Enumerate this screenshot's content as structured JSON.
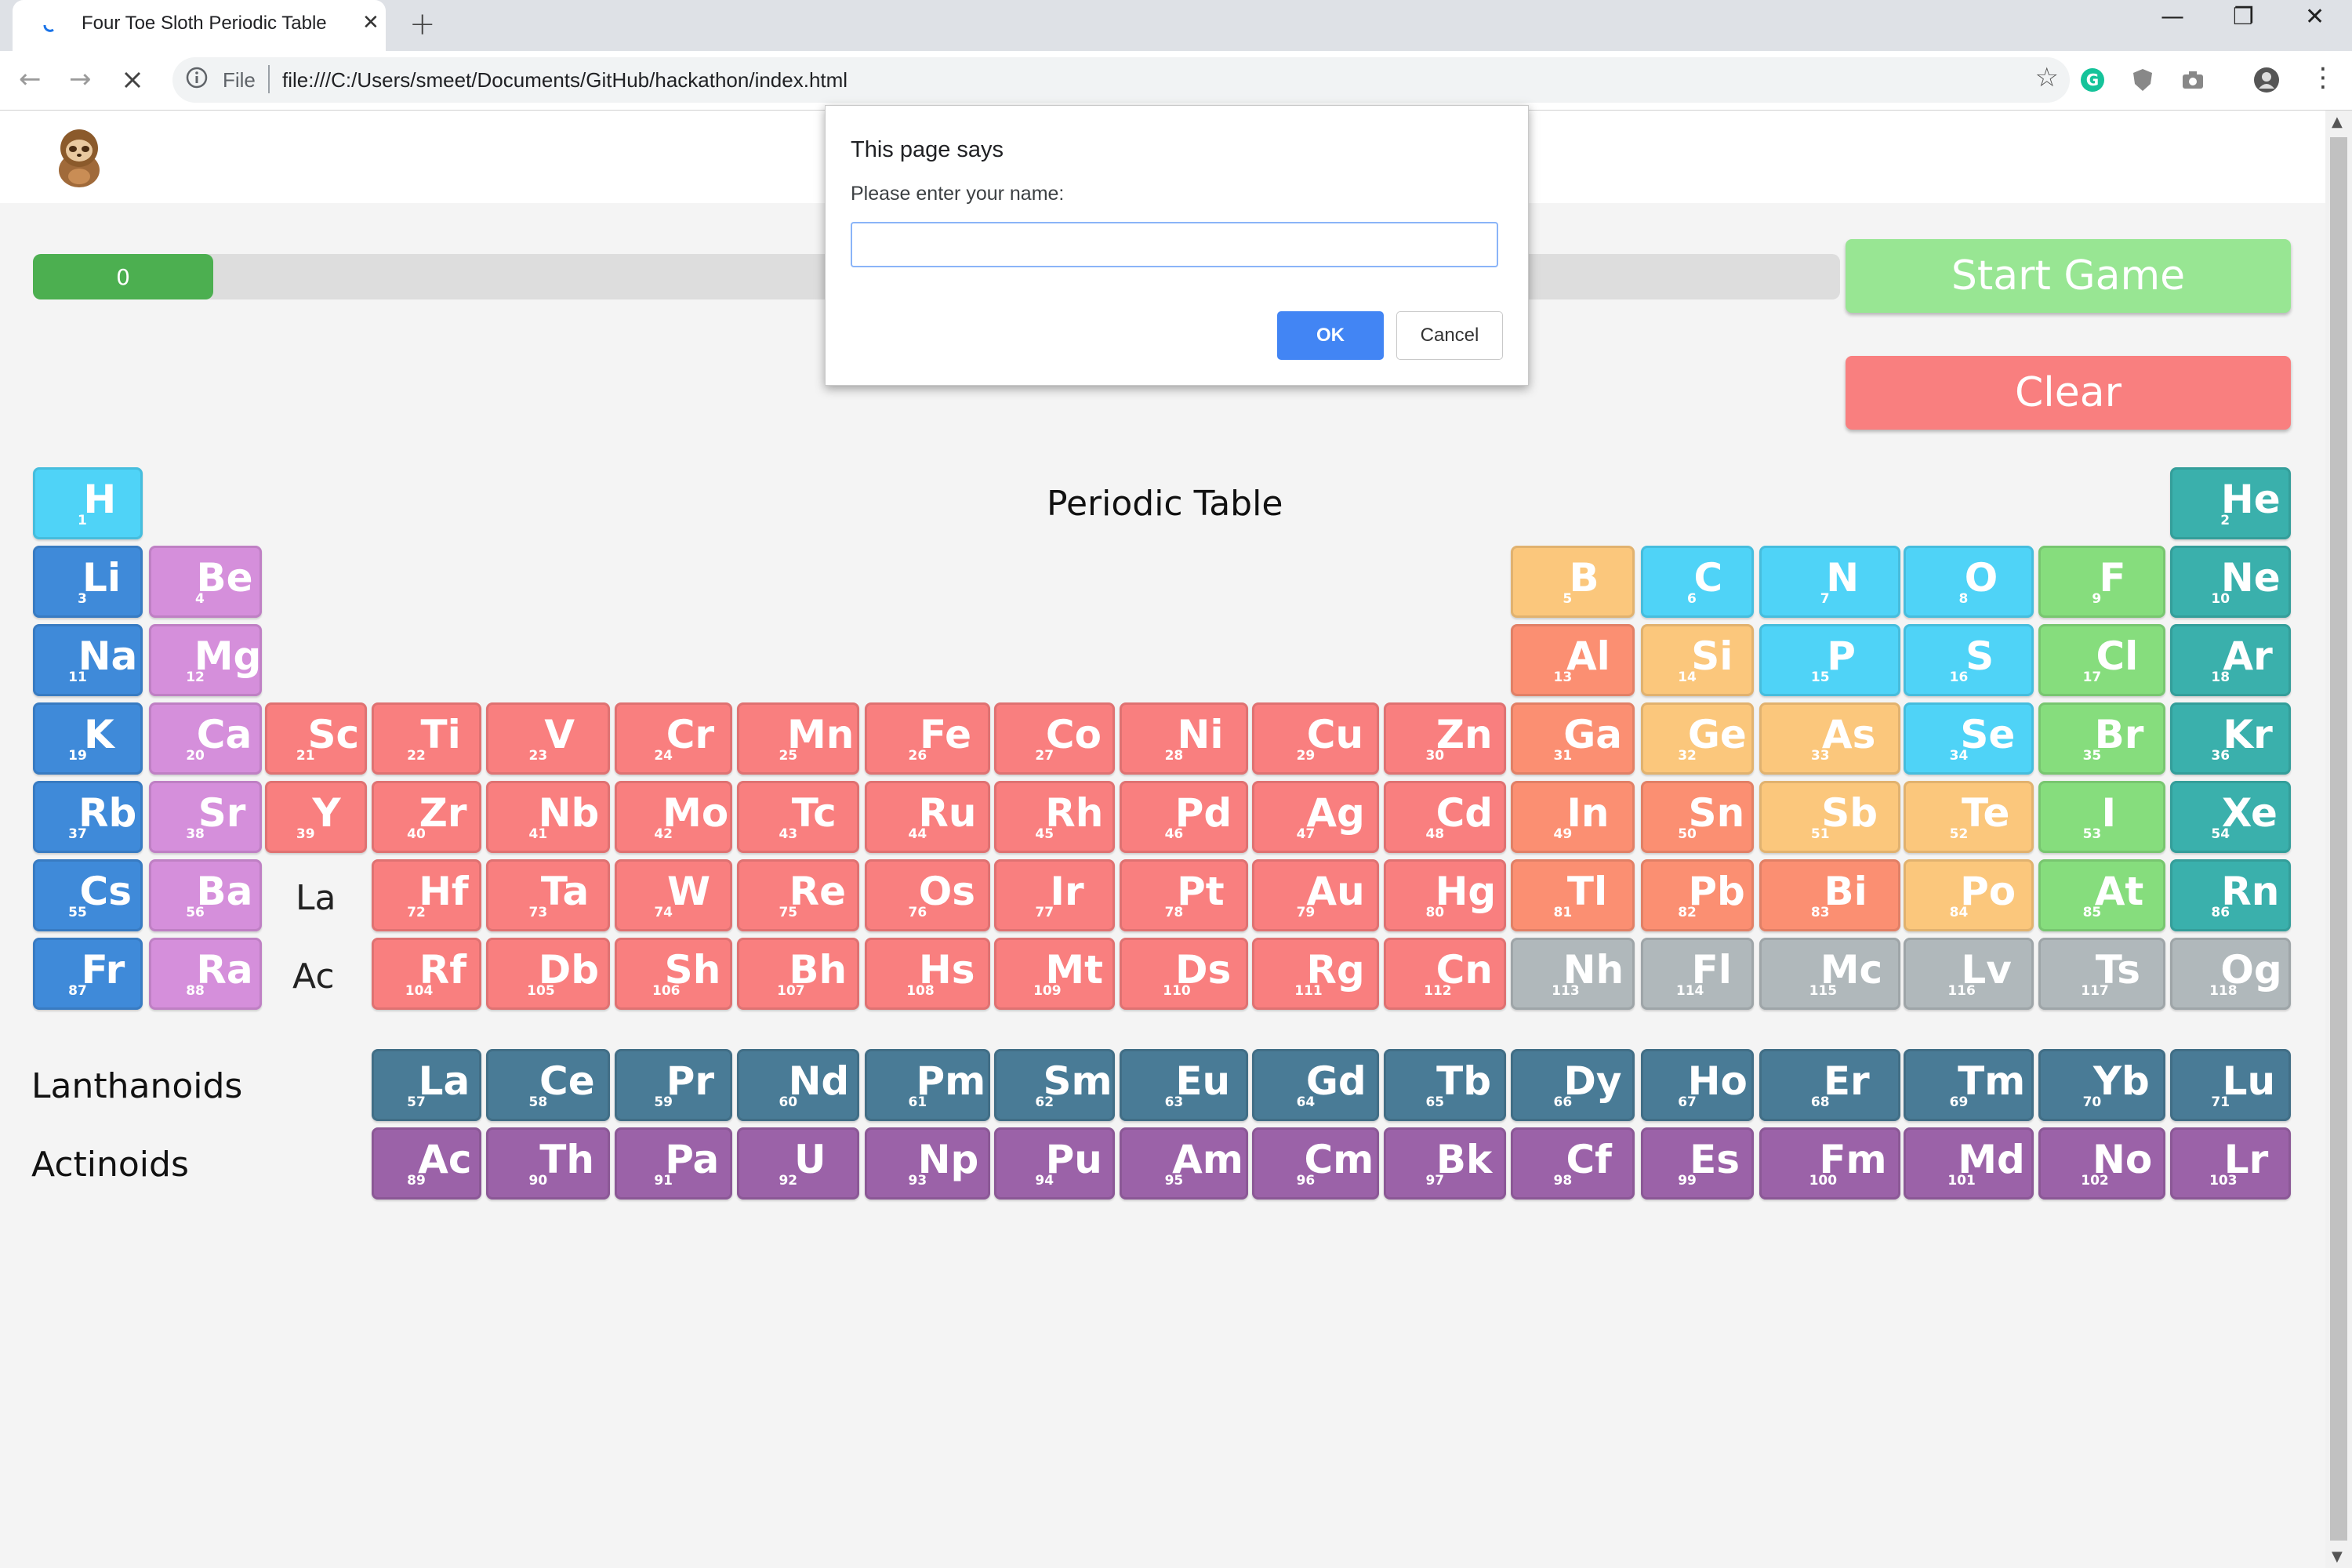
{
  "browser": {
    "tab_title": "Four Toe Sloth Periodic Table",
    "tab_close": "✕",
    "new_tab": "+",
    "scheme": "File",
    "url": "file:///C:/Users/smeet/Documents/GitHub/hackathon/index.html",
    "window_controls": [
      "—",
      "❐",
      "✕"
    ]
  },
  "game": {
    "progress_value": "0",
    "start_label": "Start Game",
    "clear_label": "Clear",
    "table_title": "Periodic Table",
    "lanthanide_placeholder": "La",
    "actinide_placeholder": "Ac",
    "lanthanoids_label": "Lanthanoids",
    "actinoids_label": "Actinoids"
  },
  "colors": {
    "alkali": "#3f8ad9",
    "alkaline_earth": "#d58fdb",
    "transition": "#f97f7f",
    "post_transition": "#fb8f72",
    "metalloid": "#fbc77c",
    "nonmetal": "#4fd3f7",
    "halogen": "#86dd7d",
    "noble_gas": "#3ab0ac",
    "unknown": "#b0b8bb",
    "lanthanide": "#497b96",
    "actinide": "#9b62a8"
  },
  "elements": [
    {
      "n": "1",
      "s": "H",
      "c": "nonmetal",
      "col": 1,
      "row": 1
    },
    {
      "n": "2",
      "s": "He",
      "c": "noble_gas",
      "col": 18,
      "row": 1
    },
    {
      "n": "3",
      "s": "Li",
      "c": "alkali",
      "col": 1,
      "row": 2
    },
    {
      "n": "4",
      "s": "Be",
      "c": "alkaline_earth",
      "col": 2,
      "row": 2
    },
    {
      "n": "5",
      "s": "B",
      "c": "metalloid",
      "col": 13,
      "row": 2
    },
    {
      "n": "6",
      "s": "C",
      "c": "nonmetal",
      "col": 14,
      "row": 2
    },
    {
      "n": "7",
      "s": "N",
      "c": "nonmetal",
      "col": 15,
      "row": 2
    },
    {
      "n": "8",
      "s": "O",
      "c": "nonmetal",
      "col": 16,
      "row": 2
    },
    {
      "n": "9",
      "s": "F",
      "c": "halogen",
      "col": 17,
      "row": 2
    },
    {
      "n": "10",
      "s": "Ne",
      "c": "noble_gas",
      "col": 18,
      "row": 2
    },
    {
      "n": "11",
      "s": "Na",
      "c": "alkali",
      "col": 1,
      "row": 3
    },
    {
      "n": "12",
      "s": "Mg",
      "c": "alkaline_earth",
      "col": 2,
      "row": 3
    },
    {
      "n": "13",
      "s": "Al",
      "c": "post_transition",
      "col": 13,
      "row": 3
    },
    {
      "n": "14",
      "s": "Si",
      "c": "metalloid",
      "col": 14,
      "row": 3
    },
    {
      "n": "15",
      "s": "P",
      "c": "nonmetal",
      "col": 15,
      "row": 3
    },
    {
      "n": "16",
      "s": "S",
      "c": "nonmetal",
      "col": 16,
      "row": 3
    },
    {
      "n": "17",
      "s": "Cl",
      "c": "halogen",
      "col": 17,
      "row": 3
    },
    {
      "n": "18",
      "s": "Ar",
      "c": "noble_gas",
      "col": 18,
      "row": 3
    },
    {
      "n": "19",
      "s": "K",
      "c": "alkali",
      "col": 1,
      "row": 4
    },
    {
      "n": "20",
      "s": "Ca",
      "c": "alkaline_earth",
      "col": 2,
      "row": 4
    },
    {
      "n": "21",
      "s": "Sc",
      "c": "transition",
      "col": 3,
      "row": 4
    },
    {
      "n": "22",
      "s": "Ti",
      "c": "transition",
      "col": 4,
      "row": 4
    },
    {
      "n": "23",
      "s": "V",
      "c": "transition",
      "col": 5,
      "row": 4
    },
    {
      "n": "24",
      "s": "Cr",
      "c": "transition",
      "col": 6,
      "row": 4
    },
    {
      "n": "25",
      "s": "Mn",
      "c": "transition",
      "col": 7,
      "row": 4
    },
    {
      "n": "26",
      "s": "Fe",
      "c": "transition",
      "col": 8,
      "row": 4
    },
    {
      "n": "27",
      "s": "Co",
      "c": "transition",
      "col": 9,
      "row": 4
    },
    {
      "n": "28",
      "s": "Ni",
      "c": "transition",
      "col": 10,
      "row": 4
    },
    {
      "n": "29",
      "s": "Cu",
      "c": "transition",
      "col": 11,
      "row": 4
    },
    {
      "n": "30",
      "s": "Zn",
      "c": "transition",
      "col": 12,
      "row": 4
    },
    {
      "n": "31",
      "s": "Ga",
      "c": "post_transition",
      "col": 13,
      "row": 4
    },
    {
      "n": "32",
      "s": "Ge",
      "c": "metalloid",
      "col": 14,
      "row": 4
    },
    {
      "n": "33",
      "s": "As",
      "c": "metalloid",
      "col": 15,
      "row": 4
    },
    {
      "n": "34",
      "s": "Se",
      "c": "nonmetal",
      "col": 16,
      "row": 4
    },
    {
      "n": "35",
      "s": "Br",
      "c": "halogen",
      "col": 17,
      "row": 4
    },
    {
      "n": "36",
      "s": "Kr",
      "c": "noble_gas",
      "col": 18,
      "row": 4
    },
    {
      "n": "37",
      "s": "Rb",
      "c": "alkali",
      "col": 1,
      "row": 5
    },
    {
      "n": "38",
      "s": "Sr",
      "c": "alkaline_earth",
      "col": 2,
      "row": 5
    },
    {
      "n": "39",
      "s": "Y",
      "c": "transition",
      "col": 3,
      "row": 5
    },
    {
      "n": "40",
      "s": "Zr",
      "c": "transition",
      "col": 4,
      "row": 5
    },
    {
      "n": "41",
      "s": "Nb",
      "c": "transition",
      "col": 5,
      "row": 5
    },
    {
      "n": "42",
      "s": "Mo",
      "c": "transition",
      "col": 6,
      "row": 5
    },
    {
      "n": "43",
      "s": "Tc",
      "c": "transition",
      "col": 7,
      "row": 5
    },
    {
      "n": "44",
      "s": "Ru",
      "c": "transition",
      "col": 8,
      "row": 5
    },
    {
      "n": "45",
      "s": "Rh",
      "c": "transition",
      "col": 9,
      "row": 5
    },
    {
      "n": "46",
      "s": "Pd",
      "c": "transition",
      "col": 10,
      "row": 5
    },
    {
      "n": "47",
      "s": "Ag",
      "c": "transition",
      "col": 11,
      "row": 5
    },
    {
      "n": "48",
      "s": "Cd",
      "c": "transition",
      "col": 12,
      "row": 5
    },
    {
      "n": "49",
      "s": "In",
      "c": "post_transition",
      "col": 13,
      "row": 5
    },
    {
      "n": "50",
      "s": "Sn",
      "c": "post_transition",
      "col": 14,
      "row": 5
    },
    {
      "n": "51",
      "s": "Sb",
      "c": "metalloid",
      "col": 15,
      "row": 5
    },
    {
      "n": "52",
      "s": "Te",
      "c": "metalloid",
      "col": 16,
      "row": 5
    },
    {
      "n": "53",
      "s": "I",
      "c": "halogen",
      "col": 17,
      "row": 5
    },
    {
      "n": "54",
      "s": "Xe",
      "c": "noble_gas",
      "col": 18,
      "row": 5
    },
    {
      "n": "55",
      "s": "Cs",
      "c": "alkali",
      "col": 1,
      "row": 6
    },
    {
      "n": "56",
      "s": "Ba",
      "c": "alkaline_earth",
      "col": 2,
      "row": 6
    },
    {
      "n": "72",
      "s": "Hf",
      "c": "transition",
      "col": 4,
      "row": 6
    },
    {
      "n": "73",
      "s": "Ta",
      "c": "transition",
      "col": 5,
      "row": 6
    },
    {
      "n": "74",
      "s": "W",
      "c": "transition",
      "col": 6,
      "row": 6
    },
    {
      "n": "75",
      "s": "Re",
      "c": "transition",
      "col": 7,
      "row": 6
    },
    {
      "n": "76",
      "s": "Os",
      "c": "transition",
      "col": 8,
      "row": 6
    },
    {
      "n": "77",
      "s": "Ir",
      "c": "transition",
      "col": 9,
      "row": 6
    },
    {
      "n": "78",
      "s": "Pt",
      "c": "transition",
      "col": 10,
      "row": 6
    },
    {
      "n": "79",
      "s": "Au",
      "c": "transition",
      "col": 11,
      "row": 6
    },
    {
      "n": "80",
      "s": "Hg",
      "c": "transition",
      "col": 12,
      "row": 6
    },
    {
      "n": "81",
      "s": "Tl",
      "c": "post_transition",
      "col": 13,
      "row": 6
    },
    {
      "n": "82",
      "s": "Pb",
      "c": "post_transition",
      "col": 14,
      "row": 6
    },
    {
      "n": "83",
      "s": "Bi",
      "c": "post_transition",
      "col": 15,
      "row": 6
    },
    {
      "n": "84",
      "s": "Po",
      "c": "metalloid",
      "col": 16,
      "row": 6
    },
    {
      "n": "85",
      "s": "At",
      "c": "halogen",
      "col": 17,
      "row": 6
    },
    {
      "n": "86",
      "s": "Rn",
      "c": "noble_gas",
      "col": 18,
      "row": 6
    },
    {
      "n": "87",
      "s": "Fr",
      "c": "alkali",
      "col": 1,
      "row": 7
    },
    {
      "n": "88",
      "s": "Ra",
      "c": "alkaline_earth",
      "col": 2,
      "row": 7
    },
    {
      "n": "104",
      "s": "Rf",
      "c": "transition",
      "col": 4,
      "row": 7
    },
    {
      "n": "105",
      "s": "Db",
      "c": "transition",
      "col": 5,
      "row": 7
    },
    {
      "n": "106",
      "s": "Sh",
      "c": "transition",
      "col": 6,
      "row": 7
    },
    {
      "n": "107",
      "s": "Bh",
      "c": "transition",
      "col": 7,
      "row": 7
    },
    {
      "n": "108",
      "s": "Hs",
      "c": "transition",
      "col": 8,
      "row": 7
    },
    {
      "n": "109",
      "s": "Mt",
      "c": "transition",
      "col": 9,
      "row": 7
    },
    {
      "n": "110",
      "s": "Ds",
      "c": "transition",
      "col": 10,
      "row": 7
    },
    {
      "n": "111",
      "s": "Rg",
      "c": "transition",
      "col": 11,
      "row": 7
    },
    {
      "n": "112",
      "s": "Cn",
      "c": "transition",
      "col": 12,
      "row": 7
    },
    {
      "n": "113",
      "s": "Nh",
      "c": "unknown",
      "col": 13,
      "row": 7
    },
    {
      "n": "114",
      "s": "Fl",
      "c": "unknown",
      "col": 14,
      "row": 7
    },
    {
      "n": "115",
      "s": "Mc",
      "c": "unknown",
      "col": 15,
      "row": 7
    },
    {
      "n": "116",
      "s": "Lv",
      "c": "unknown",
      "col": 16,
      "row": 7
    },
    {
      "n": "117",
      "s": "Ts",
      "c": "unknown",
      "col": 17,
      "row": 7
    },
    {
      "n": "118",
      "s": "Og",
      "c": "unknown",
      "col": 18,
      "row": 7
    },
    {
      "n": "57",
      "s": "La",
      "c": "lanthanide",
      "col": 4,
      "row": 8
    },
    {
      "n": "58",
      "s": "Ce",
      "c": "lanthanide",
      "col": 5,
      "row": 8
    },
    {
      "n": "59",
      "s": "Pr",
      "c": "lanthanide",
      "col": 6,
      "row": 8
    },
    {
      "n": "60",
      "s": "Nd",
      "c": "lanthanide",
      "col": 7,
      "row": 8
    },
    {
      "n": "61",
      "s": "Pm",
      "c": "lanthanide",
      "col": 8,
      "row": 8
    },
    {
      "n": "62",
      "s": "Sm",
      "c": "lanthanide",
      "col": 9,
      "row": 8
    },
    {
      "n": "63",
      "s": "Eu",
      "c": "lanthanide",
      "col": 10,
      "row": 8
    },
    {
      "n": "64",
      "s": "Gd",
      "c": "lanthanide",
      "col": 11,
      "row": 8
    },
    {
      "n": "65",
      "s": "Tb",
      "c": "lanthanide",
      "col": 12,
      "row": 8
    },
    {
      "n": "66",
      "s": "Dy",
      "c": "lanthanide",
      "col": 13,
      "row": 8
    },
    {
      "n": "67",
      "s": "Ho",
      "c": "lanthanide",
      "col": 14,
      "row": 8
    },
    {
      "n": "68",
      "s": "Er",
      "c": "lanthanide",
      "col": 15,
      "row": 8
    },
    {
      "n": "69",
      "s": "Tm",
      "c": "lanthanide",
      "col": 16,
      "row": 8
    },
    {
      "n": "70",
      "s": "Yb",
      "c": "lanthanide",
      "col": 17,
      "row": 8
    },
    {
      "n": "71",
      "s": "Lu",
      "c": "lanthanide",
      "col": 18,
      "row": 8
    },
    {
      "n": "89",
      "s": "Ac",
      "c": "actinide",
      "col": 4,
      "row": 9
    },
    {
      "n": "90",
      "s": "Th",
      "c": "actinide",
      "col": 5,
      "row": 9
    },
    {
      "n": "91",
      "s": "Pa",
      "c": "actinide",
      "col": 6,
      "row": 9
    },
    {
      "n": "92",
      "s": "U",
      "c": "actinide",
      "col": 7,
      "row": 9
    },
    {
      "n": "93",
      "s": "Np",
      "c": "actinide",
      "col": 8,
      "row": 9
    },
    {
      "n": "94",
      "s": "Pu",
      "c": "actinide",
      "col": 9,
      "row": 9
    },
    {
      "n": "95",
      "s": "Am",
      "c": "actinide",
      "col": 10,
      "row": 9
    },
    {
      "n": "96",
      "s": "Cm",
      "c": "actinide",
      "col": 11,
      "row": 9
    },
    {
      "n": "97",
      "s": "Bk",
      "c": "actinide",
      "col": 12,
      "row": 9
    },
    {
      "n": "98",
      "s": "Cf",
      "c": "actinide",
      "col": 13,
      "row": 9
    },
    {
      "n": "99",
      "s": "Es",
      "c": "actinide",
      "col": 14,
      "row": 9
    },
    {
      "n": "100",
      "s": "Fm",
      "c": "actinide",
      "col": 15,
      "row": 9
    },
    {
      "n": "101",
      "s": "Md",
      "c": "actinide",
      "col": 16,
      "row": 9
    },
    {
      "n": "102",
      "s": "No",
      "c": "actinide",
      "col": 17,
      "row": 9
    },
    {
      "n": "103",
      "s": "Lr",
      "c": "actinide",
      "col": 18,
      "row": 9
    }
  ],
  "dialog": {
    "title": "This page says",
    "message": "Please enter your name:",
    "input_value": "",
    "ok_label": "OK",
    "cancel_label": "Cancel"
  }
}
